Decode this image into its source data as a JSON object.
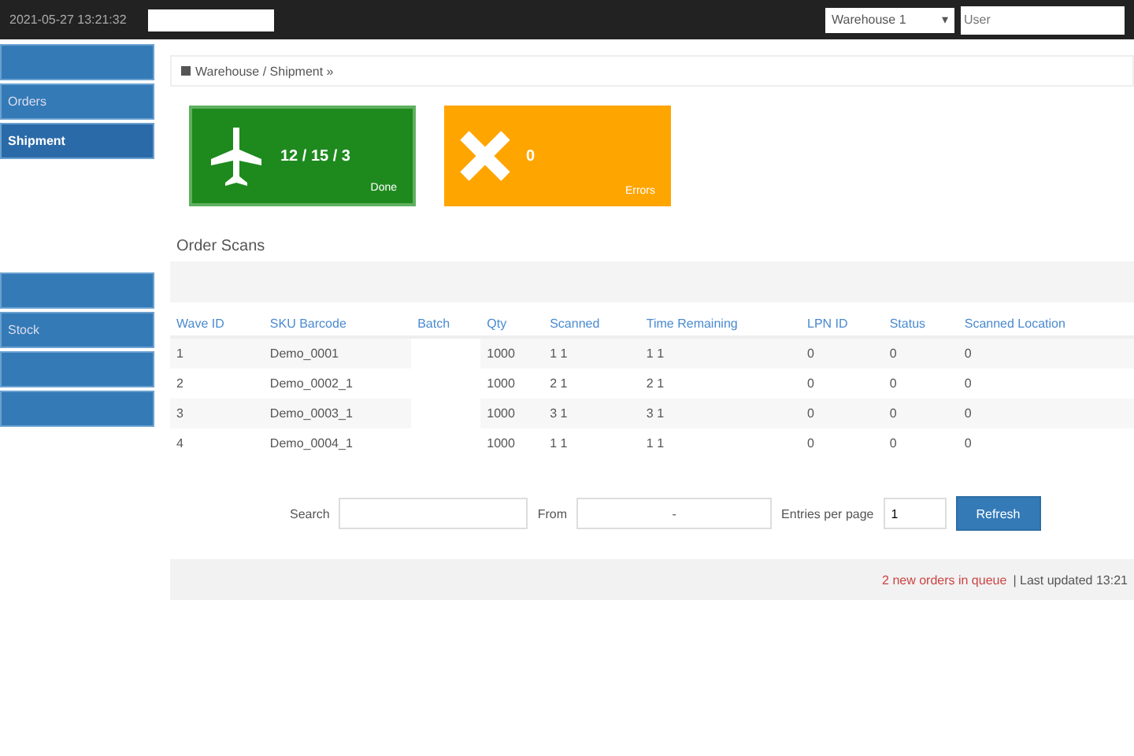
{
  "topbar": {
    "datetime": "2021-05-27 13:21:32",
    "select": "Warehouse 1",
    "select_caret": "▾",
    "user_field": {
      "placeholder": "User"
    }
  },
  "sidebar": {
    "groups": [
      [
        {
          "selected": false
        },
        {
          "label": "Orders",
          "selected": false
        },
        {
          "label": "Shipment",
          "selected": true
        }
      ],
      [
        {
          "selected": false
        },
        {
          "label": "Stock",
          "selected": false
        },
        {
          "selected": false
        },
        {
          "selected": false
        }
      ]
    ]
  },
  "breadcrumb": "Warehouse / Shipment »",
  "tiles": [
    {
      "kind": "plane",
      "value": "12 / 15 / 3",
      "caption": "Done"
    },
    {
      "kind": "cross",
      "value": "0",
      "caption": "Errors"
    }
  ],
  "section_title": "Order Scans",
  "table": {
    "columns": [
      "Wave ID",
      "SKU Barcode",
      "Batch",
      "Qty",
      "Scanned",
      "Time Remaining",
      "LPN ID",
      "Status",
      "Scanned Location"
    ],
    "rows": [
      [
        "1",
        "Demo_0001",
        null,
        "1000",
        "1 1",
        "1 1",
        "0",
        "0",
        "0"
      ],
      [
        "2",
        "Demo_0002_1",
        null,
        "1000",
        "2 1",
        "2 1",
        "0",
        "0",
        "0"
      ],
      [
        "3",
        "Demo_0003_1",
        null,
        "1000",
        "3 1",
        "3 1",
        "0",
        "0",
        "0"
      ],
      [
        "4",
        "Demo_0004_1",
        null,
        "1000",
        "1 1",
        "1 1",
        "0",
        "0",
        "0"
      ]
    ]
  },
  "filters": {
    "search_label": "Search",
    "from_label": "From",
    "from_value": "-",
    "per_page_label": "Entries per page",
    "per_page_value": "1",
    "button": "Refresh"
  },
  "footer": {
    "status": "2 new orders in queue",
    "note": "| Last updated 13:21"
  }
}
